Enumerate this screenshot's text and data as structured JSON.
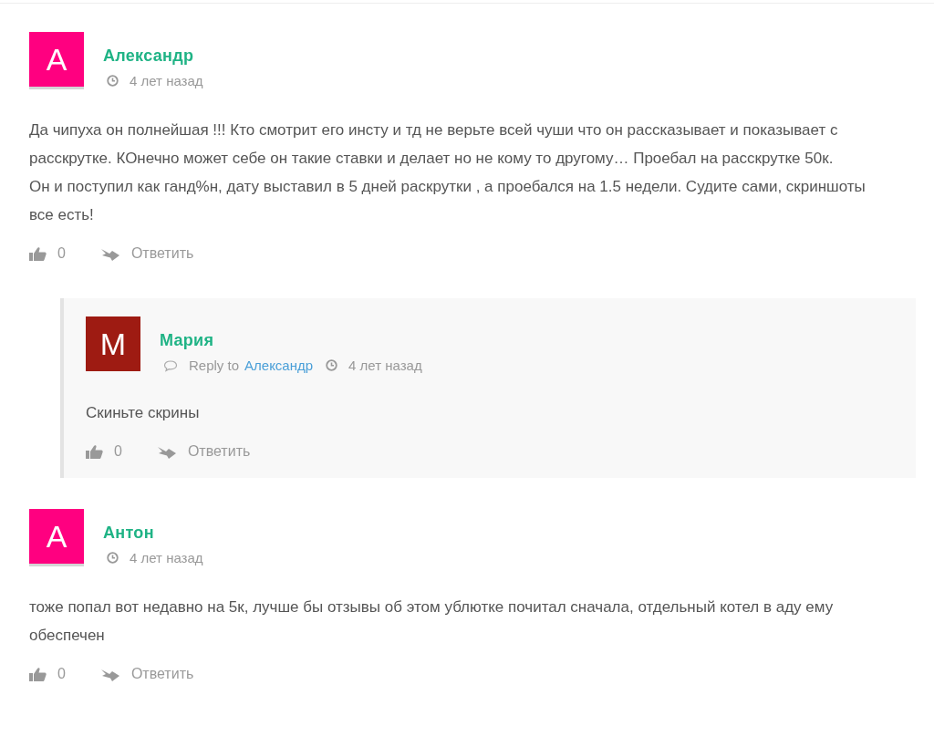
{
  "comments": [
    {
      "avatar_letter": "А",
      "color": "#ff0080",
      "author": "Александр",
      "time": "4 лет назад",
      "body": [
        "Да чипуха он полнейшая !!! Кто смотрит его инсту и тд не верьте всей чуши что он рассказывает и показывает с расскрутке. КОнечно может себе он такие ставки и делает но не кому то другому… Проебал на расскрутке 50к.",
        "Он и поступил как ганд%н, дату выставил в 5 дней раскрутки , а проебался на 1.5 недели. Судите сами, скриншоты все есть!"
      ],
      "likes": "0",
      "reply_label": "Ответить",
      "children": [
        {
          "avatar_letter": "М",
          "color": "#9e1b12",
          "author": "Мария",
          "reply_prefix": "Reply to",
          "reply_to": "Александр",
          "time": "4 лет назад",
          "body": [
            "Скиньте скрины"
          ],
          "likes": "0",
          "reply_label": "Ответить"
        }
      ]
    },
    {
      "avatar_letter": "А",
      "color": "#ff0080",
      "author": "Антон",
      "time": "4 лет назад",
      "body": [
        "тоже попал вот недавно на 5к, лучше бы отзывы об этом ублютке почитал сначала, отдельный котел в аду ему обеспечен"
      ],
      "likes": "0",
      "reply_label": "Ответить"
    }
  ]
}
